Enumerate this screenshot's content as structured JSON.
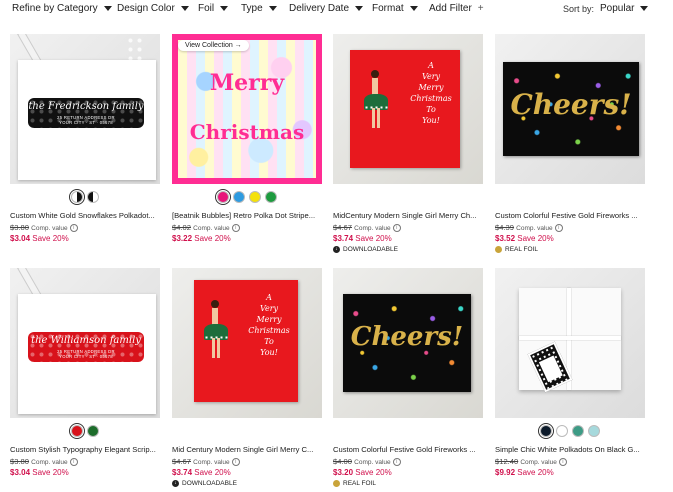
{
  "filters": {
    "items": [
      {
        "label": "Refine by Category"
      },
      {
        "label": "Design Color"
      },
      {
        "label": "Foil"
      },
      {
        "label": "Type"
      },
      {
        "label": "Delivery Date"
      },
      {
        "label": "Format"
      }
    ],
    "add_filter": "Add Filter",
    "add_icon": "+",
    "sort_label": "Sort by:",
    "sort_value": "Popular"
  },
  "common": {
    "comp_value": "Comp. value",
    "info_icon": "i"
  },
  "products": [
    {
      "title": "Custom White Gold Snowflakes Polkadot...",
      "old_price": "$3.80",
      "price": "$3.04",
      "save": "Save 20%",
      "badge": "",
      "art": {
        "family": "the Fredrickson family",
        "address": "25 RETURN ADDRESS DR\nYOUR CITY · ST · 05678"
      }
    },
    {
      "title": "[Beatnik Bubbles] Retro Polka Dot Stripe...",
      "old_price": "$4.02",
      "price": "$3.22",
      "save": "Save 20%",
      "badge": "",
      "art": {
        "line1": "Merry",
        "line2": "Christmas",
        "pill": "View Collection →"
      }
    },
    {
      "title": "MidCentury Modern Single Girl Merry Ch...",
      "old_price": "$4.67",
      "price": "$3.74",
      "save": "Save 20%",
      "badge": "DOWNLOADABLE",
      "art": {
        "text": "A\nVery\nMerry\nChristmas\nTo\nYou!"
      }
    },
    {
      "title": "Custom Colorful Festive Gold Fireworks ...",
      "old_price": "$4.39",
      "price": "$3.52",
      "save": "Save 20%",
      "badge": "REAL FOIL",
      "art": {
        "text": "Cheers!"
      }
    },
    {
      "title": "Custom Stylish Typography Elegant Scrip...",
      "old_price": "$3.80",
      "price": "$3.04",
      "save": "Save 20%",
      "badge": "",
      "art": {
        "family": "the Williamson family",
        "address": "25 RETURN ADDRESS DR\nYOUR CITY · ST · 05678"
      }
    },
    {
      "title": "Mid Century Modern Single Girl Merry C...",
      "old_price": "$4.67",
      "price": "$3.74",
      "save": "Save 20%",
      "badge": "DOWNLOADABLE",
      "art": {
        "text": "A\nVery\nMerry\nChristmas\nTo\nYou!"
      }
    },
    {
      "title": "Custom Colorful Festive Gold Fireworks ...",
      "old_price": "$4.00",
      "price": "$3.20",
      "save": "Save 20%",
      "badge": "REAL FOIL",
      "art": {
        "text": "Cheers!"
      }
    },
    {
      "title": "Simple Chic White Polkadots On Black G...",
      "old_price": "$12.40",
      "price": "$9.92",
      "save": "Save 20%",
      "badge": "",
      "art": {}
    }
  ],
  "swatches": {
    "p0": [
      {
        "color": "#ffffff",
        "selected": true
      },
      {
        "color": "#111111"
      }
    ],
    "p1": [
      {
        "color": "#e8157a",
        "selected": true
      },
      {
        "color": "#2e9be0"
      },
      {
        "color": "#f4e10a"
      },
      {
        "color": "#1d9b3f"
      }
    ],
    "p4": [
      {
        "color": "#d8121b",
        "selected": true
      },
      {
        "color": "#1d6d2b"
      }
    ],
    "p7": [
      {
        "color": "#0c1a2a",
        "selected": true
      },
      {
        "color": "#ffffff"
      },
      {
        "color": "#3d9b85"
      },
      {
        "color": "#a6d9dc"
      }
    ]
  },
  "colors": {
    "sale": "#d0104c",
    "accent_pink": "#ff2d93",
    "foil_gold": "#c9a43a"
  }
}
